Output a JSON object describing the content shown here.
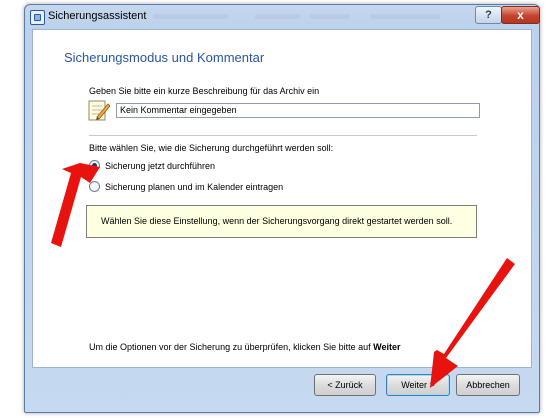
{
  "window": {
    "title": "Sicherungsassistent",
    "help_glyph": "?",
    "close_glyph": "x"
  },
  "page": {
    "heading": "Sicherungsmodus und Kommentar",
    "description_label": "Geben Sie bitte ein kurze Beschreibung für das Archiv ein",
    "comment_value": "Kein Kommentar eingegeben",
    "mode_label": "Bitte wählen Sie, wie die Sicherung durchgeführt werden soll:",
    "options": [
      {
        "label": "Sicherung jetzt durchführen",
        "checked": true
      },
      {
        "label": "Sicherung planen und im Kalender eintragen",
        "checked": false
      }
    ],
    "info_text": "Wählen Sie diese Einstellung, wenn der Sicherungsvorgang direkt gestartet werden soll.",
    "bottom_text": "Um die Optionen vor der Sicherung zu überprüfen, klicken Sie bitte auf",
    "bottom_bold": "Weiter"
  },
  "buttons": {
    "back": "< Zurück",
    "next": "Weiter >",
    "cancel": "Abbrechen"
  },
  "colors": {
    "heading": "#2a55a6",
    "info_background": "#ffffe1",
    "annotation_arrow": "#e8120f"
  },
  "icons": {
    "app": "backup-app-icon",
    "comment": "note-pencil-icon",
    "annotation": "red-arrow-icon"
  }
}
